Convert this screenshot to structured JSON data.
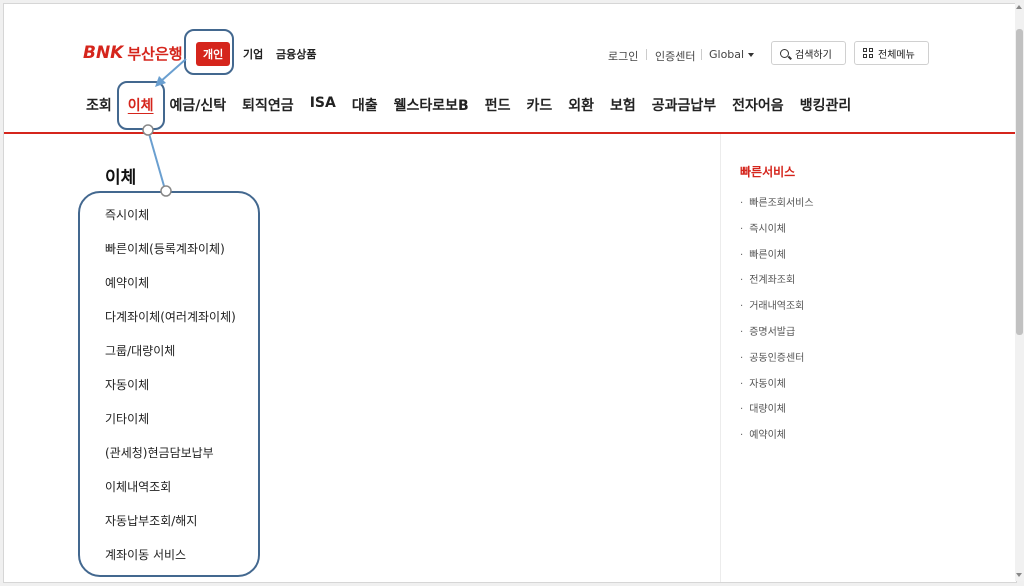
{
  "header": {
    "logo_bnk": "BNK",
    "logo_name": "부산은행",
    "tabs": [
      "개인",
      "기업",
      "금융상품"
    ]
  },
  "util": {
    "login": "로그인",
    "cert_center": "인증센터",
    "global": "Global",
    "search_button": "검색하기",
    "all_menu_button": "전체메뉴"
  },
  "gnb": [
    "조회",
    "이체",
    "예금/신탁",
    "퇴직연금",
    "ISA",
    "대출",
    "웰스타로보B",
    "펀드",
    "카드",
    "외환",
    "보험",
    "공과금납부",
    "전자어음",
    "뱅킹관리"
  ],
  "gnb_active_index": 1,
  "section": {
    "title": "이체",
    "items": [
      "즉시이체",
      "빠른이체(등록계좌이체)",
      "예약이체",
      "다계좌이체(여러계좌이체)",
      "그룹/대량이체",
      "자동이체",
      "기타이체",
      "(관세청)현금담보납부",
      "이체내역조회",
      "자동납부조회/해지",
      "계좌이동 서비스"
    ]
  },
  "quick": {
    "title": "빠른서비스",
    "items": [
      "빠른조회서비스",
      "즉시이체",
      "빠른이체",
      "전계좌조회",
      "거래내역조회",
      "증명서발급",
      "공동인증센터",
      "자동이체",
      "대량이체",
      "예약이체"
    ]
  },
  "colors": {
    "brand_red": "#d5251c",
    "annotation_blue": "#43688f"
  }
}
